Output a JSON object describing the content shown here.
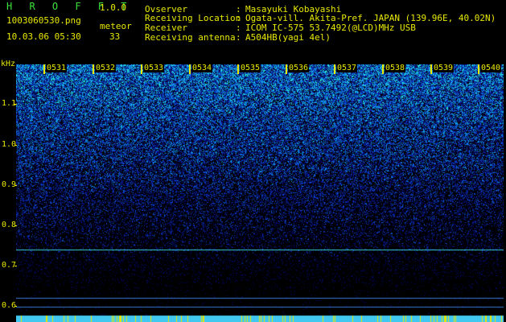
{
  "header": {
    "app_title": "H R O F F T",
    "version": "1.0.0",
    "file_name": "1003060530.png",
    "mode_label": "meteor",
    "date_time": "10.03.06 05:30",
    "count": "33",
    "info": [
      {
        "label": "Ovserver",
        "value": "Masayuki Kobayashi"
      },
      {
        "label": "Receiving Location",
        "value": "Ogata-vill. Akita-Pref. JAPAN (139.96E, 40.02N)"
      },
      {
        "label": "Receiver",
        "value": "ICOM IC-575 53.7492(@LCD)MHz USB"
      },
      {
        "label": "Receiving antenna",
        "value": "A504HB(yagi 4el)"
      }
    ]
  },
  "axis": {
    "unit_label": "kHz",
    "y_ticks": [
      "1.1",
      "1.0",
      "0.9",
      "0.8",
      "0.7",
      "0.6"
    ],
    "x_ticks": [
      "0531",
      "0532",
      "0533",
      "0534",
      "0535",
      "0536",
      "0537",
      "0538",
      "0539",
      "0540"
    ]
  },
  "colors": {
    "text": "#e8e800",
    "title": "#3ce23c",
    "background": "#000000",
    "signal_low": "#0a1a6e",
    "signal_high": "#40e0e8"
  }
}
